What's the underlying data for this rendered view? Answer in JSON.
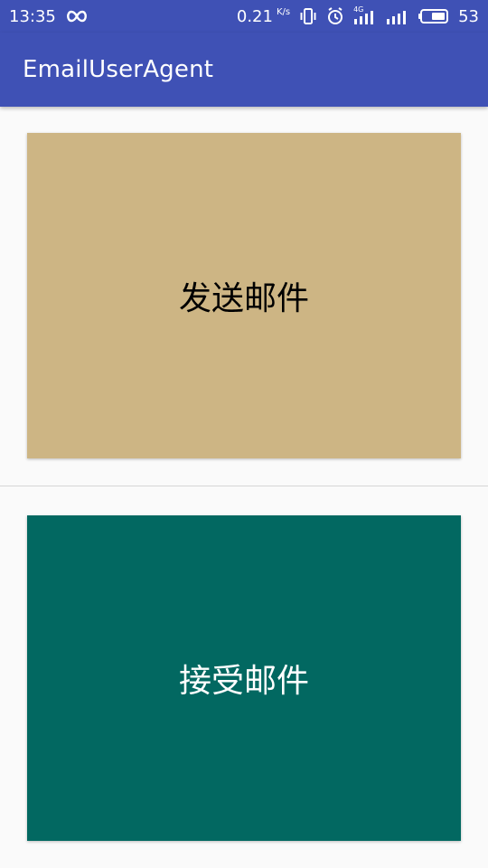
{
  "status_bar": {
    "time": "13:35",
    "net_speed": "0.21",
    "net_speed_unit": "K/s",
    "signal_label": "4G",
    "battery_percent": "53",
    "icons": [
      "infinity-icon",
      "vibrate-icon",
      "alarm-icon",
      "signal-4g-icon",
      "signal-icon",
      "battery-icon"
    ]
  },
  "app_bar": {
    "title": "EmailUserAgent",
    "color": "#3f51b5"
  },
  "panels": {
    "send": {
      "label": "发送邮件",
      "color": "#cdb584"
    },
    "receive": {
      "label": "接受邮件",
      "color": "#026861"
    }
  }
}
